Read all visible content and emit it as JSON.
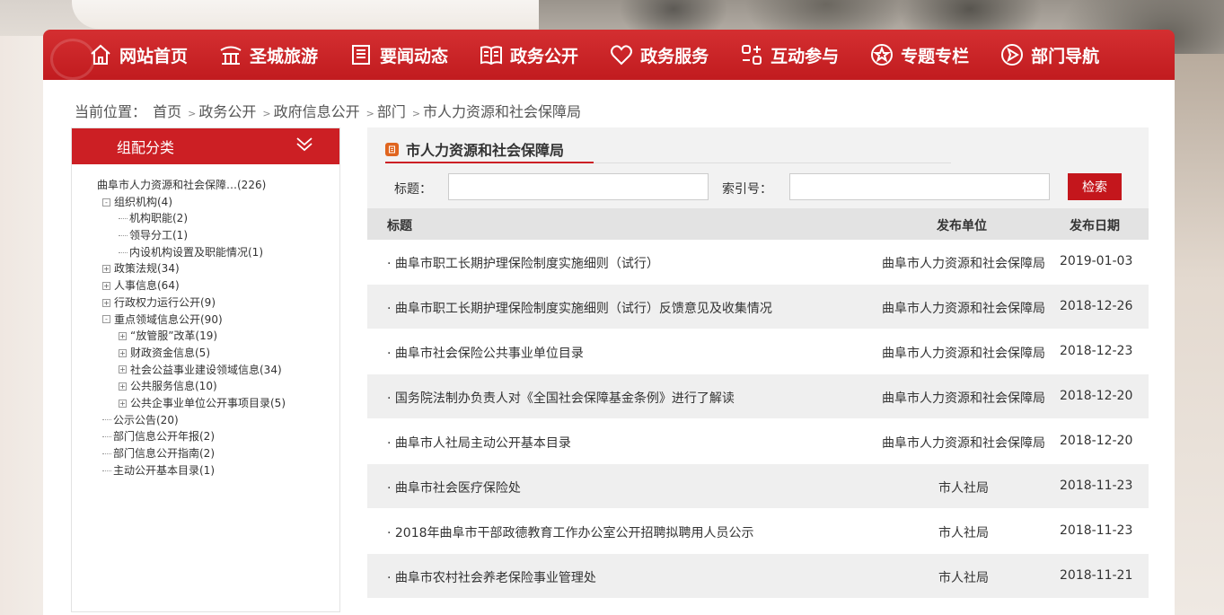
{
  "nav": {
    "items": [
      {
        "label": "网站首页",
        "icon": "home-icon"
      },
      {
        "label": "圣城旅游",
        "icon": "temple-icon"
      },
      {
        "label": "要闻动态",
        "icon": "news-icon"
      },
      {
        "label": "政务公开",
        "icon": "book-icon"
      },
      {
        "label": "政务服务",
        "icon": "heart-icon"
      },
      {
        "label": "互动参与",
        "icon": "interact-icon"
      },
      {
        "label": "专题专栏",
        "icon": "star-icon"
      },
      {
        "label": "部门导航",
        "icon": "compass-icon"
      }
    ]
  },
  "breadcrumb": {
    "prefix": "当前位置：",
    "items": [
      "首页",
      "政务公开",
      "政府信息公开",
      "部门",
      "市人力资源和社会保障局"
    ],
    "separator": ">"
  },
  "sidebar": {
    "title": "组配分类",
    "tree": [
      {
        "label": "曲阜市人力资源和社会保障…(226)",
        "level": 0,
        "toggle": ""
      },
      {
        "label": "组织机构(4)",
        "level": 1,
        "toggle": "-"
      },
      {
        "label": "机构职能(2)",
        "level": 2,
        "toggle": "leaf"
      },
      {
        "label": "领导分工(1)",
        "level": 2,
        "toggle": "leaf"
      },
      {
        "label": "内设机构设置及职能情况(1)",
        "level": 2,
        "toggle": "leaf"
      },
      {
        "label": "政策法规(34)",
        "level": 1,
        "toggle": "+"
      },
      {
        "label": "人事信息(64)",
        "level": 1,
        "toggle": "+"
      },
      {
        "label": "行政权力运行公开(9)",
        "level": 1,
        "toggle": "+"
      },
      {
        "label": "重点领域信息公开(90)",
        "level": 1,
        "toggle": "-"
      },
      {
        "label": "“放管服”改革(19)",
        "level": 2,
        "toggle": "+"
      },
      {
        "label": "财政资金信息(5)",
        "level": 2,
        "toggle": "+"
      },
      {
        "label": "社会公益事业建设领域信息(34)",
        "level": 2,
        "toggle": "+"
      },
      {
        "label": "公共服务信息(10)",
        "level": 2,
        "toggle": "+"
      },
      {
        "label": "公共企事业单位公开事项目录(5)",
        "level": 2,
        "toggle": "+"
      },
      {
        "label": "公示公告(20)",
        "level": 1,
        "toggle": "leaf"
      },
      {
        "label": "部门信息公开年报(2)",
        "level": 1,
        "toggle": "leaf"
      },
      {
        "label": "部门信息公开指南(2)",
        "level": 1,
        "toggle": "leaf"
      },
      {
        "label": "主动公开基本目录(1)",
        "level": 1,
        "toggle": "leaf"
      }
    ]
  },
  "content": {
    "title": "市人力资源和社会保障局",
    "search": {
      "title_label": "标题：",
      "title_value": "",
      "index_label": "索引号：",
      "index_value": "",
      "button": "检索"
    },
    "columns": {
      "title": "标题",
      "unit": "发布单位",
      "date": "发布日期"
    },
    "rows": [
      {
        "title": "· 曲阜市职工长期护理保险制度实施细则（试行）",
        "unit": "曲阜市人力资源和社会保障局",
        "date": "2019-01-03"
      },
      {
        "title": "· 曲阜市职工长期护理保险制度实施细则（试行）反馈意见及收集情况",
        "unit": "曲阜市人力资源和社会保障局",
        "date": "2018-12-26"
      },
      {
        "title": "· 曲阜市社会保险公共事业单位目录",
        "unit": "曲阜市人力资源和社会保障局",
        "date": "2018-12-23"
      },
      {
        "title": "· 国务院法制办负责人对《全国社会保障基金条例》进行了解读",
        "unit": "曲阜市人力资源和社会保障局",
        "date": "2018-12-20"
      },
      {
        "title": "· 曲阜市人社局主动公开基本目录",
        "unit": "曲阜市人力资源和社会保障局",
        "date": "2018-12-20"
      },
      {
        "title": "· 曲阜市社会医疗保险处",
        "unit": "市人社局",
        "date": "2018-11-23"
      },
      {
        "title": "· 2018年曲阜市干部政德教育工作办公室公开招聘拟聘用人员公示",
        "unit": "市人社局",
        "date": "2018-11-23"
      },
      {
        "title": "· 曲阜市农村社会养老保险事业管理处",
        "unit": "市人社局",
        "date": "2018-11-21"
      }
    ]
  },
  "colors": {
    "brand_red": "#cc1f24",
    "nav_red": "#c11b1f",
    "doc_icon": "#e0651f"
  }
}
